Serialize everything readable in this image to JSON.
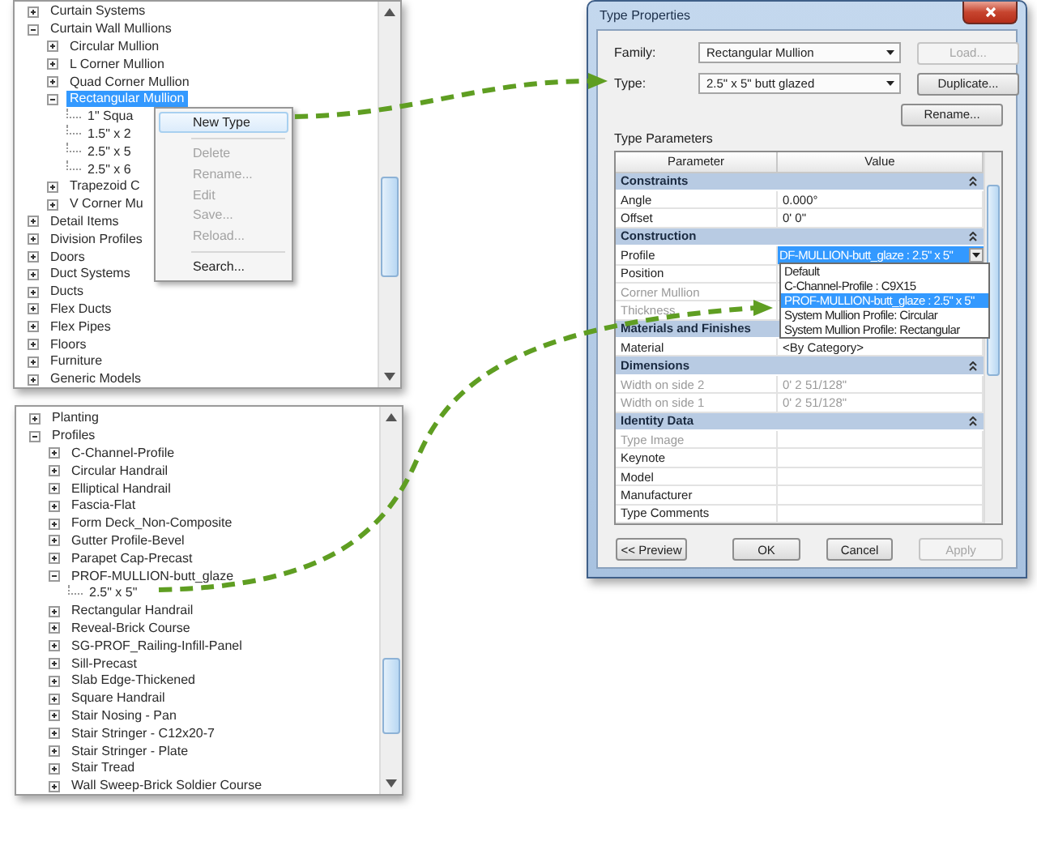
{
  "top_tree": {
    "items": [
      {
        "label": "Curtain Systems",
        "expanded": false,
        "selected": false
      },
      {
        "label": "Curtain Wall Mullions",
        "expanded": true,
        "selected": false,
        "children": [
          {
            "label": "Circular Mullion",
            "expanded": false,
            "selected": false
          },
          {
            "label": "L Corner Mullion",
            "expanded": false,
            "selected": false
          },
          {
            "label": "Quad Corner Mullion",
            "expanded": false,
            "selected": false
          },
          {
            "label": "Rectangular Mullion",
            "expanded": true,
            "selected": true,
            "children": [
              {
                "label": "1\" Squa",
                "selected": false
              },
              {
                "label": "1.5\" x 2",
                "selected": false
              },
              {
                "label": "2.5\" x 5",
                "selected": false
              },
              {
                "label": "2.5\" x 6",
                "selected": false
              }
            ]
          },
          {
            "label": "Trapezoid C",
            "expanded": false,
            "selected": false
          },
          {
            "label": "V Corner Mu",
            "expanded": false,
            "selected": false
          }
        ]
      },
      {
        "label": "Detail Items",
        "expanded": false,
        "selected": false
      },
      {
        "label": "Division Profiles",
        "expanded": false,
        "selected": false
      },
      {
        "label": "Doors",
        "expanded": false,
        "selected": false
      },
      {
        "label": "Duct Systems",
        "expanded": false,
        "selected": false
      },
      {
        "label": "Ducts",
        "expanded": false,
        "selected": false
      },
      {
        "label": "Flex Ducts",
        "expanded": false,
        "selected": false
      },
      {
        "label": "Flex Pipes",
        "expanded": false,
        "selected": false
      },
      {
        "label": "Floors",
        "expanded": false,
        "selected": false
      },
      {
        "label": "Furniture",
        "expanded": false,
        "selected": false
      },
      {
        "label": "Generic Models",
        "expanded": false,
        "selected": false
      }
    ]
  },
  "context_menu": {
    "items": [
      {
        "kind": "item",
        "label": "New Type",
        "disabled": false,
        "highlighted": true
      },
      {
        "kind": "separator"
      },
      {
        "kind": "item",
        "label": "Delete",
        "disabled": true,
        "highlighted": false
      },
      {
        "kind": "item",
        "label": "Rename...",
        "disabled": true,
        "highlighted": false
      },
      {
        "kind": "item",
        "label": "Edit",
        "disabled": true,
        "highlighted": false
      },
      {
        "kind": "item",
        "label": "Save...",
        "disabled": true,
        "highlighted": false
      },
      {
        "kind": "item",
        "label": "Reload...",
        "disabled": true,
        "highlighted": false
      },
      {
        "kind": "separator"
      },
      {
        "kind": "item",
        "label": "Search...",
        "disabled": false,
        "highlighted": false
      }
    ]
  },
  "bottom_tree": {
    "items": [
      {
        "label": "Planting",
        "expanded": false,
        "selected": false
      },
      {
        "label": "Profiles",
        "expanded": true,
        "selected": false,
        "children": [
          {
            "label": "C-Channel-Profile",
            "expanded": false,
            "selected": false
          },
          {
            "label": "Circular Handrail",
            "expanded": false,
            "selected": false
          },
          {
            "label": "Elliptical Handrail",
            "expanded": false,
            "selected": false
          },
          {
            "label": "Fascia-Flat",
            "expanded": false,
            "selected": false
          },
          {
            "label": "Form Deck_Non-Composite",
            "expanded": false,
            "selected": false
          },
          {
            "label": "Gutter Profile-Bevel",
            "expanded": false,
            "selected": false
          },
          {
            "label": "Parapet Cap-Precast",
            "expanded": false,
            "selected": false
          },
          {
            "label": "PROF-MULLION-butt_glaze",
            "expanded": true,
            "selected": false,
            "children": [
              {
                "label": "2.5\" x 5\"",
                "selected": false
              }
            ]
          },
          {
            "label": "Rectangular Handrail",
            "expanded": false,
            "selected": false
          },
          {
            "label": "Reveal-Brick Course",
            "expanded": false,
            "selected": false
          },
          {
            "label": "SG-PROF_Railing-Infill-Panel",
            "expanded": false,
            "selected": false
          },
          {
            "label": "Sill-Precast",
            "expanded": false,
            "selected": false
          },
          {
            "label": "Slab Edge-Thickened",
            "expanded": false,
            "selected": false
          },
          {
            "label": "Square Handrail",
            "expanded": false,
            "selected": false
          },
          {
            "label": "Stair Nosing - Pan",
            "expanded": false,
            "selected": false
          },
          {
            "label": "Stair Stringer - C12x20-7",
            "expanded": false,
            "selected": false
          },
          {
            "label": "Stair Stringer - Plate",
            "expanded": false,
            "selected": false
          },
          {
            "label": "Stair Tread",
            "expanded": false,
            "selected": false
          },
          {
            "label": "Wall Sweep-Brick Soldier Course",
            "expanded": false,
            "selected": false
          }
        ]
      }
    ]
  },
  "dialog": {
    "title": "Type Properties",
    "family": {
      "label": "Family:",
      "value": "Rectangular Mullion"
    },
    "type": {
      "label": "Type:",
      "value": "2.5\" x 5\" butt glazed"
    },
    "side_buttons": [
      {
        "label": "Load...",
        "disabled": true
      },
      {
        "label": "Duplicate...",
        "disabled": false
      },
      {
        "label": "Rename...",
        "disabled": false
      }
    ],
    "section_label": "Type Parameters",
    "columns": [
      "Parameter",
      "Value"
    ],
    "groups": [
      {
        "title": "Constraints",
        "expanded": true,
        "rows": [
          {
            "kind": "text",
            "name": "Angle",
            "value": "0.000°",
            "disabled": false
          },
          {
            "kind": "text",
            "name": "Offset",
            "value": "0'  0\"",
            "disabled": false
          }
        ]
      },
      {
        "title": "Construction",
        "expanded": true,
        "rows": [
          {
            "kind": "combo",
            "name": "Profile",
            "value": "DF-MULLION-butt_glaze : 2.5\" x 5\"",
            "disabled": false
          },
          {
            "kind": "text",
            "name": "Position",
            "disabled": false
          },
          {
            "kind": "text",
            "name": "Corner Mullion",
            "disabled": true
          },
          {
            "kind": "text",
            "name": "Thickness",
            "disabled": true
          }
        ]
      },
      {
        "title": "Materials and Finishes",
        "expanded": true,
        "rows": [
          {
            "kind": "text",
            "name": "Material",
            "value": "<By Category>",
            "disabled": false
          }
        ]
      },
      {
        "title": "Dimensions",
        "expanded": true,
        "rows": [
          {
            "kind": "text",
            "name": "Width on side 2",
            "value": "0'  2 51/128\"",
            "disabled": true
          },
          {
            "kind": "text",
            "name": "Width on side 1",
            "value": "0'  2 51/128\"",
            "disabled": true
          }
        ]
      },
      {
        "title": "Identity Data",
        "expanded": true,
        "rows": [
          {
            "kind": "text",
            "name": "Type Image",
            "disabled": true
          },
          {
            "kind": "text",
            "name": "Keynote",
            "disabled": false
          },
          {
            "kind": "text",
            "name": "Model",
            "disabled": false
          },
          {
            "kind": "text",
            "name": "Manufacturer",
            "disabled": false
          },
          {
            "kind": "text",
            "name": "Type Comments",
            "disabled": false
          }
        ]
      }
    ],
    "profile_options": [
      {
        "label": "Default",
        "selected": false
      },
      {
        "label": "C-Channel-Profile : C9X15",
        "selected": false
      },
      {
        "label": "PROF-MULLION-butt_glaze : 2.5\" x 5\"",
        "selected": true
      },
      {
        "label": "System Mullion Profile: Circular",
        "selected": false
      },
      {
        "label": "System Mullion Profile: Rectangular",
        "selected": false
      }
    ],
    "footer_buttons": [
      {
        "label": "<< Preview",
        "disabled": false
      },
      {
        "label": "OK",
        "disabled": false
      },
      {
        "label": "Cancel",
        "disabled": false
      },
      {
        "label": "Apply",
        "disabled": true
      }
    ]
  }
}
